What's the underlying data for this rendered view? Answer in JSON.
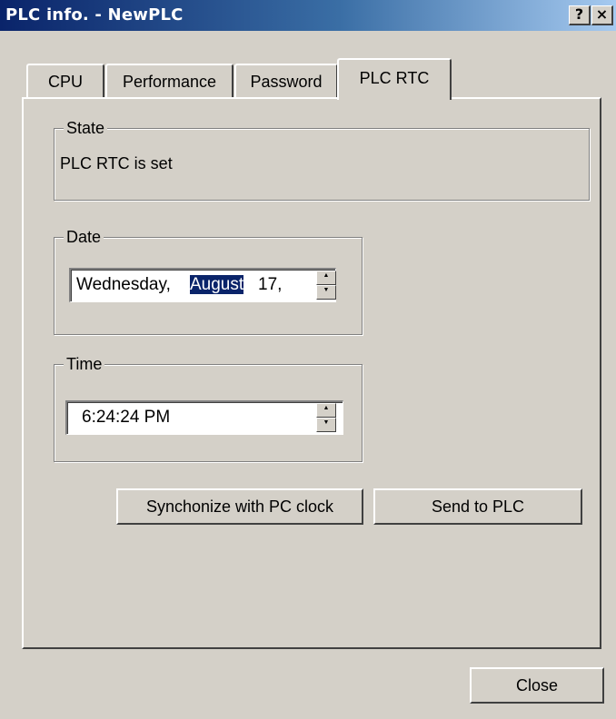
{
  "window": {
    "title": "PLC info. - NewPLC",
    "help_label": "?",
    "close_label": "×"
  },
  "tabs": [
    {
      "label": "CPU"
    },
    {
      "label": "Performance"
    },
    {
      "label": "Password"
    },
    {
      "label": "PLC RTC",
      "active": true
    }
  ],
  "state_group": {
    "label": "State",
    "text": "PLC RTC is set"
  },
  "date_group": {
    "label": "Date",
    "weekday": "Wednesday,",
    "month": "August",
    "day": "17,"
  },
  "time_group": {
    "label": "Time",
    "value": "6:24:24 PM"
  },
  "spinner": {
    "up": "▲",
    "down": "▼"
  },
  "buttons": {
    "sync": "Synchonize with PC clock",
    "send": "Send to PLC",
    "close": "Close"
  },
  "colors": {
    "dialog_face": "#d4d0c8",
    "title_start": "#0a246a",
    "title_end": "#a6caf0",
    "selection": "#0a246a"
  }
}
